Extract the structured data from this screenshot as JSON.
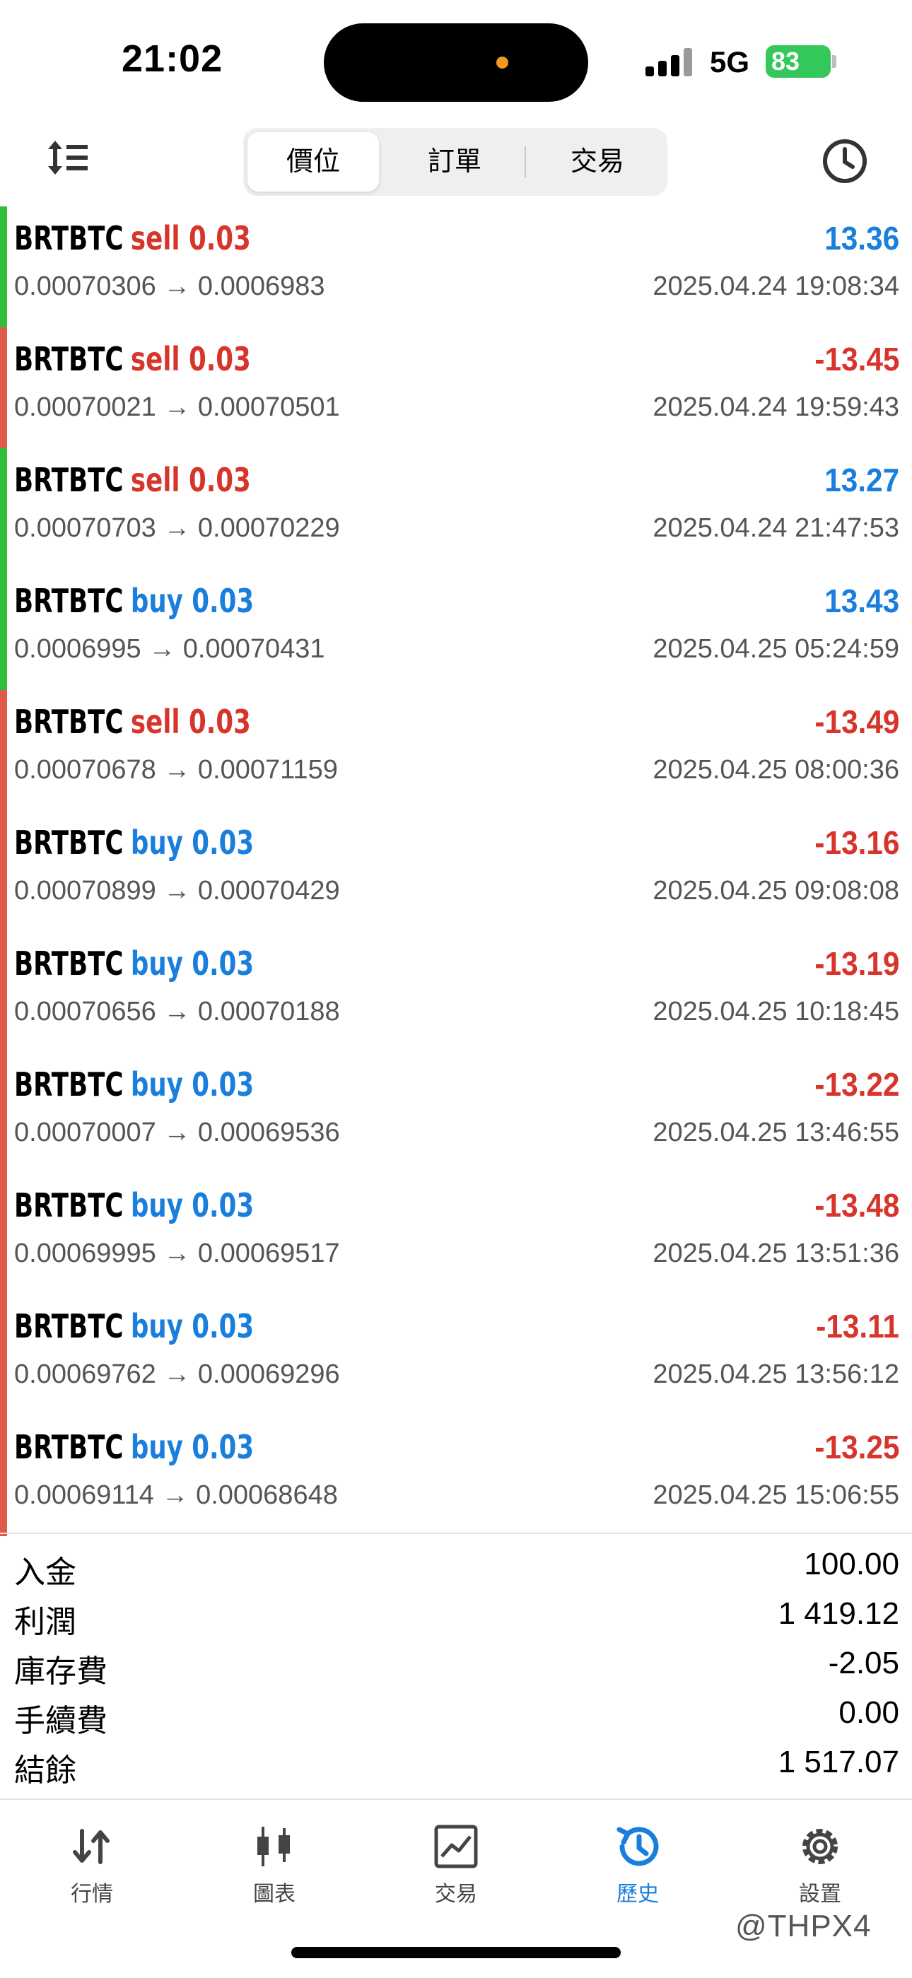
{
  "status": {
    "time": "21:02",
    "network": "5G",
    "battery": "83"
  },
  "toolbar": {
    "tabs": [
      "價位",
      "訂單",
      "交易"
    ]
  },
  "trades": [
    {
      "symbol": "BRTBTC",
      "side": "sell",
      "volume": "0.03",
      "open": "0.00070306",
      "close": "0.0006983",
      "profit": "13.36",
      "time": "2025.04.24 19:08:34",
      "bar": "#2fbd3a",
      "sideColor": "red",
      "profitColor": "blue"
    },
    {
      "symbol": "BRTBTC",
      "side": "sell",
      "volume": "0.03",
      "open": "0.00070021",
      "close": "0.00070501",
      "profit": "-13.45",
      "time": "2025.04.24 19:59:43",
      "bar": "#e05a4c",
      "sideColor": "red",
      "profitColor": "red"
    },
    {
      "symbol": "BRTBTC",
      "side": "sell",
      "volume": "0.03",
      "open": "0.00070703",
      "close": "0.00070229",
      "profit": "13.27",
      "time": "2025.04.24 21:47:53",
      "bar": "#2fbd3a",
      "sideColor": "red",
      "profitColor": "blue"
    },
    {
      "symbol": "BRTBTC",
      "side": "buy",
      "volume": "0.03",
      "open": "0.0006995",
      "close": "0.00070431",
      "profit": "13.43",
      "time": "2025.04.25 05:24:59",
      "bar": "#2fbd3a",
      "sideColor": "blue",
      "profitColor": "blue"
    },
    {
      "symbol": "BRTBTC",
      "side": "sell",
      "volume": "0.03",
      "open": "0.00070678",
      "close": "0.00071159",
      "profit": "-13.49",
      "time": "2025.04.25 08:00:36",
      "bar": "#e05a4c",
      "sideColor": "red",
      "profitColor": "red"
    },
    {
      "symbol": "BRTBTC",
      "side": "buy",
      "volume": "0.03",
      "open": "0.00070899",
      "close": "0.00070429",
      "profit": "-13.16",
      "time": "2025.04.25 09:08:08",
      "bar": "#e05a4c",
      "sideColor": "blue",
      "profitColor": "red"
    },
    {
      "symbol": "BRTBTC",
      "side": "buy",
      "volume": "0.03",
      "open": "0.00070656",
      "close": "0.00070188",
      "profit": "-13.19",
      "time": "2025.04.25 10:18:45",
      "bar": "#e05a4c",
      "sideColor": "blue",
      "profitColor": "red"
    },
    {
      "symbol": "BRTBTC",
      "side": "buy",
      "volume": "0.03",
      "open": "0.00070007",
      "close": "0.00069536",
      "profit": "-13.22",
      "time": "2025.04.25 13:46:55",
      "bar": "#e05a4c",
      "sideColor": "blue",
      "profitColor": "red"
    },
    {
      "symbol": "BRTBTC",
      "side": "buy",
      "volume": "0.03",
      "open": "0.00069995",
      "close": "0.00069517",
      "profit": "-13.48",
      "time": "2025.04.25 13:51:36",
      "bar": "#e05a4c",
      "sideColor": "blue",
      "profitColor": "red"
    },
    {
      "symbol": "BRTBTC",
      "side": "buy",
      "volume": "0.03",
      "open": "0.00069762",
      "close": "0.00069296",
      "profit": "-13.11",
      "time": "2025.04.25 13:56:12",
      "bar": "#e05a4c",
      "sideColor": "blue",
      "profitColor": "red"
    },
    {
      "symbol": "BRTBTC",
      "side": "buy",
      "volume": "0.03",
      "open": "0.00069114",
      "close": "0.00068648",
      "profit": "-13.25",
      "time": "2025.04.25 15:06:55",
      "bar": "#e05a4c",
      "sideColor": "blue",
      "profitColor": "red"
    }
  ],
  "summary": [
    {
      "label": "入金",
      "value": "100.00"
    },
    {
      "label": "利潤",
      "value": "1 419.12"
    },
    {
      "label": "庫存費",
      "value": "-2.05"
    },
    {
      "label": "手續費",
      "value": "0.00"
    },
    {
      "label": "結餘",
      "value": "1 517.07"
    }
  ],
  "tabbar": [
    {
      "label": "行情",
      "icon": "quotes-icon"
    },
    {
      "label": "圖表",
      "icon": "chart-icon"
    },
    {
      "label": "交易",
      "icon": "trade-icon"
    },
    {
      "label": "歷史",
      "icon": "history-icon",
      "active": true
    },
    {
      "label": "設置",
      "icon": "settings-icon"
    }
  ],
  "watermark": "@THPX4"
}
